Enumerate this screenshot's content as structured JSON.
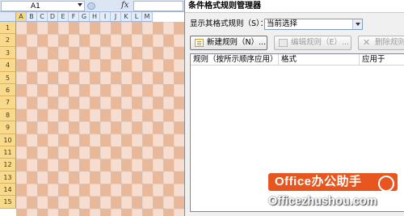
{
  "excel": {
    "name_box": "A1",
    "fx_label": "fx",
    "columns": [
      "A",
      "B",
      "C",
      "D",
      "E",
      "F",
      "G",
      "H",
      "I",
      "J",
      "K",
      "L",
      "M"
    ],
    "rows": [
      "1",
      "2",
      "3",
      "4",
      "5",
      "6",
      "7",
      "8",
      "9",
      "10",
      "11",
      "12",
      "13",
      "14",
      "15"
    ],
    "selected_column": "A",
    "checker_colors": {
      "light": "#f6ddd0",
      "dark": "#e8b899"
    }
  },
  "dialog": {
    "title": "条件格式规则管理器",
    "show_rules_label": "显示其格式规则（S）：",
    "show_rules_value": "当前选择",
    "buttons": {
      "new_rule": "新建规则（N）...",
      "edit_rule": "编辑规则（E）...",
      "delete_rule": "删除规则"
    },
    "columns": {
      "rule": "规则（按所示顺序应用）",
      "format": "格式",
      "applies_to": "应用于"
    }
  },
  "watermark": {
    "title": "Office办公助手",
    "site": "Officezhushou.com",
    "accent": "#e6561e"
  }
}
